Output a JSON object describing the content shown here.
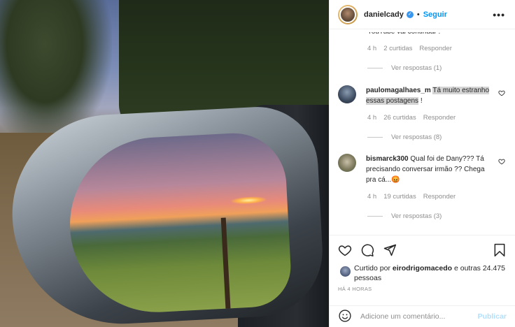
{
  "post": {
    "author": "danielcady",
    "follow_label": "Seguir",
    "separator": "•",
    "more_label": "•••"
  },
  "comments": {
    "partial_text": "YouTube vai continuar !",
    "first": {
      "time": "4 h",
      "likes": "2 curtidas",
      "reply": "Responder",
      "view_replies": "Ver respostas (1)"
    },
    "items": [
      {
        "username": "paulomagalhaes_m",
        "text_plain": " ",
        "text_highlight": "Tá muito estranho essas postagens",
        "text_tail": " !",
        "time": "4 h",
        "likes": "26 curtidas",
        "reply": "Responder",
        "view_replies": "Ver respostas (8)"
      },
      {
        "username": "bismarck300",
        "text": " Qual foi de Dany??? Tá precisando conversar irmão ?? Chega pra cá...😡",
        "time": "4 h",
        "likes": "19 curtidas",
        "reply": "Responder",
        "view_replies": "Ver respostas (3)"
      }
    ]
  },
  "icons": {
    "like": "heart-icon",
    "comment": "comment-icon",
    "share": "share-icon",
    "save": "bookmark-icon",
    "emoji": "emoji-icon",
    "verified": "verified-badge-icon"
  },
  "likes": {
    "prefix": "Curtido por ",
    "user": "eirodrigomacedo",
    "middle": " e ",
    "others": "outras 24.475 pessoas"
  },
  "time_ago": "HÁ 4 HORAS",
  "add_comment": {
    "placeholder": "Adicione um comentário...",
    "publish_label": "Publicar"
  },
  "colors": {
    "accent": "#0095f6",
    "publish_disabled": "#b2dffc",
    "secondary_text": "#8e8e8e",
    "highlight": "#d4d4d4"
  }
}
